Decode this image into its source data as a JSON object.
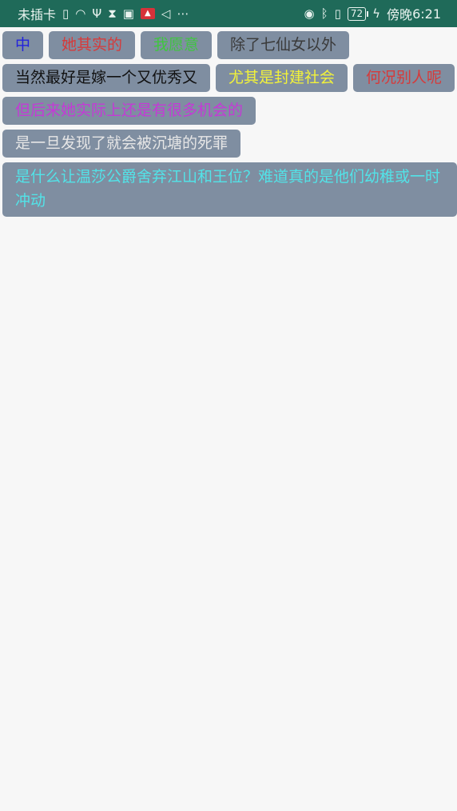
{
  "status_bar": {
    "carrier": "未插卡",
    "battery": "72",
    "time_prefix": "傍晚",
    "time": "6:21",
    "icons": [
      "sim-alert-icon",
      "wifi-icon",
      "usb-icon",
      "hourglass-icon",
      "gallery-icon",
      "app-badge-icon",
      "send-icon",
      "more-icon",
      "eye-icon",
      "bluetooth-icon",
      "vibrate-icon",
      "battery-icon",
      "charging-icon"
    ]
  },
  "tags": [
    {
      "text": "中",
      "color": "#2222dd"
    },
    {
      "text": "她其实的",
      "color": "#d63a3a"
    },
    {
      "text": "我愿意",
      "color": "#3fc63f"
    },
    {
      "text": "除了七仙女以外",
      "color": "#3a3a3a"
    },
    {
      "text": "当然最好是嫁一个又优秀又",
      "color": "#111111"
    },
    {
      "text": "尤其是封建社会",
      "color": "#f2f23a"
    },
    {
      "text": "何况别人呢",
      "color": "#d63a3a"
    },
    {
      "text": "但后来她实际上还是有很多机会的",
      "color": "#c43ad6"
    },
    {
      "text": "是一旦发现了就会被沉塘的死罪",
      "color": "#e6e6e6"
    },
    {
      "text": "是什么让温莎公爵舍弃江山和王位？难道真的是他们幼稚或一时冲动",
      "color": "#52e3e8"
    }
  ]
}
